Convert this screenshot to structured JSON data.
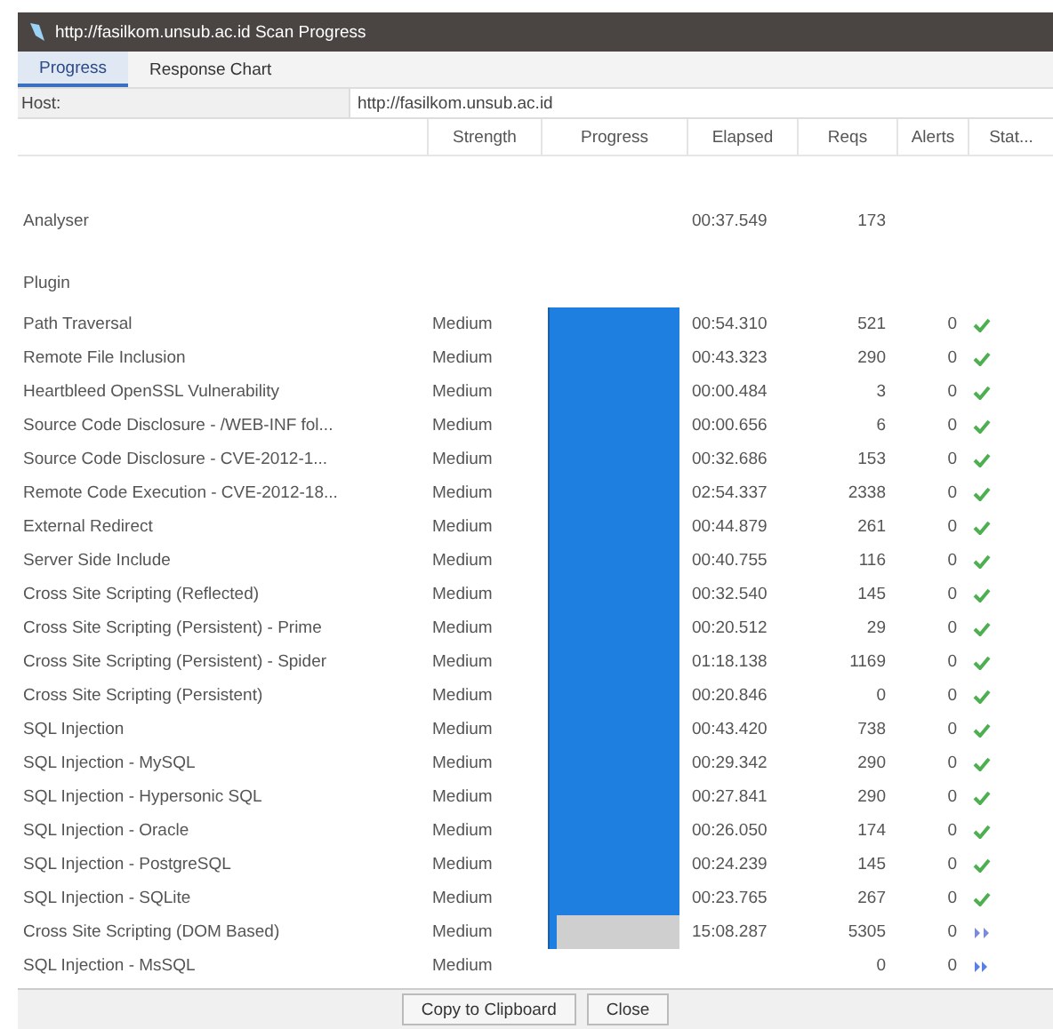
{
  "window": {
    "title": "http://fasilkom.unsub.ac.id Scan Progress"
  },
  "tabs": [
    {
      "label": "Progress",
      "selected": true
    },
    {
      "label": "Response Chart",
      "selected": false
    }
  ],
  "host": {
    "label": "Host:",
    "value": "http://fasilkom.unsub.ac.id"
  },
  "table": {
    "columns": [
      "",
      "Strength",
      "Progress",
      "Elapsed",
      "Reqs",
      "Alerts",
      "Stat..."
    ],
    "analyser": {
      "name": "Analyser",
      "elapsed": "00:37.549",
      "reqs": "173"
    },
    "section": "Plugin",
    "rows": [
      {
        "name": "Path Traversal",
        "strength": "Medium",
        "level": 1,
        "elapsed": "00:54.310",
        "reqs": "521",
        "alerts": "0",
        "kind": "done"
      },
      {
        "name": "Remote File Inclusion",
        "strength": "Medium",
        "level": 1,
        "elapsed": "00:43.323",
        "reqs": "290",
        "alerts": "0",
        "kind": "done"
      },
      {
        "name": "Heartbleed OpenSSL Vulnerability",
        "strength": "Medium",
        "level": 1,
        "elapsed": "00:00.484",
        "reqs": "3",
        "alerts": "0",
        "kind": "done"
      },
      {
        "name": "Source Code Disclosure - /WEB-INF fol...",
        "strength": "Medium",
        "level": 1,
        "elapsed": "00:00.656",
        "reqs": "6",
        "alerts": "0",
        "kind": "done"
      },
      {
        "name": "Source Code Disclosure - CVE-2012-1...",
        "strength": "Medium",
        "level": 1,
        "elapsed": "00:32.686",
        "reqs": "153",
        "alerts": "0",
        "kind": "done"
      },
      {
        "name": "Remote Code Execution - CVE-2012-18...",
        "strength": "Medium",
        "level": 1,
        "elapsed": "02:54.337",
        "reqs": "2338",
        "alerts": "0",
        "kind": "done"
      },
      {
        "name": "External Redirect",
        "strength": "Medium",
        "level": 1,
        "elapsed": "00:44.879",
        "reqs": "261",
        "alerts": "0",
        "kind": "done"
      },
      {
        "name": "Server Side Include",
        "strength": "Medium",
        "level": 1,
        "elapsed": "00:40.755",
        "reqs": "116",
        "alerts": "0",
        "kind": "done"
      },
      {
        "name": "Cross Site Scripting (Reflected)",
        "strength": "Medium",
        "level": 1,
        "elapsed": "00:32.540",
        "reqs": "145",
        "alerts": "0",
        "kind": "done"
      },
      {
        "name": "Cross Site Scripting (Persistent) - Prime",
        "strength": "Medium",
        "level": 1,
        "elapsed": "00:20.512",
        "reqs": "29",
        "alerts": "0",
        "kind": "done"
      },
      {
        "name": "Cross Site Scripting (Persistent) - Spider",
        "strength": "Medium",
        "level": 1,
        "elapsed": "01:18.138",
        "reqs": "1169",
        "alerts": "0",
        "kind": "done"
      },
      {
        "name": "Cross Site Scripting (Persistent)",
        "strength": "Medium",
        "level": 1,
        "elapsed": "00:20.846",
        "reqs": "0",
        "alerts": "0",
        "kind": "done"
      },
      {
        "name": "SQL Injection",
        "strength": "Medium",
        "level": 1,
        "elapsed": "00:43.420",
        "reqs": "738",
        "alerts": "0",
        "kind": "done"
      },
      {
        "name": "SQL Injection - MySQL",
        "strength": "Medium",
        "level": 1,
        "elapsed": "00:29.342",
        "reqs": "290",
        "alerts": "0",
        "kind": "done"
      },
      {
        "name": "SQL Injection - Hypersonic SQL",
        "strength": "Medium",
        "level": 1,
        "elapsed": "00:27.841",
        "reqs": "290",
        "alerts": "0",
        "kind": "done"
      },
      {
        "name": "SQL Injection - Oracle",
        "strength": "Medium",
        "level": 1,
        "elapsed": "00:26.050",
        "reqs": "174",
        "alerts": "0",
        "kind": "done"
      },
      {
        "name": "SQL Injection - PostgreSQL",
        "strength": "Medium",
        "level": 1,
        "elapsed": "00:24.239",
        "reqs": "145",
        "alerts": "0",
        "kind": "done"
      },
      {
        "name": "SQL Injection - SQLite",
        "strength": "Medium",
        "level": 1,
        "elapsed": "00:23.765",
        "reqs": "267",
        "alerts": "0",
        "kind": "done"
      },
      {
        "name": "Cross Site Scripting (DOM Based)",
        "strength": "Medium",
        "level": 0.06,
        "elapsed": "15:08.287",
        "reqs": "5305",
        "alerts": "0",
        "kind": "running"
      },
      {
        "name": "SQL Injection - MsSQL",
        "strength": "Medium",
        "reqs": "0",
        "alerts": "0",
        "kind": "pending"
      }
    ]
  },
  "buttons": [
    "Copy to Clipboard",
    "Close"
  ]
}
